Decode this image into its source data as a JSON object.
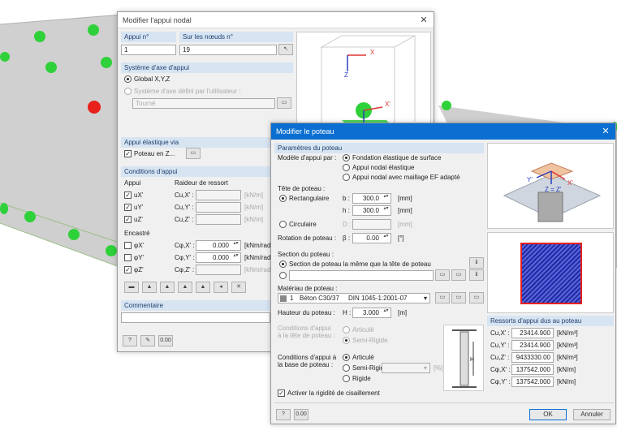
{
  "nodal_dialog": {
    "title": "Modifier l'appui nodal",
    "support_no_label": "Appui n°",
    "support_no_value": "1",
    "nodes_label": "Sur les nœuds n°",
    "nodes_value": "19",
    "axis_section": "Système d'axe d'appui",
    "global_label": "Global X,Y,Z",
    "user_axis_label": "Système d'axe défini par l'utilisateur :",
    "rotated_value": "Tourné",
    "elastic_section": "Appui élastique via",
    "column_label": "Poteau en Z...",
    "conditions_section": "Conditions d'appui",
    "support_col": "Appui",
    "spring_col": "Raideur de ressort",
    "rows_u": [
      {
        "axis": "uX'",
        "coef": "Cu,X' :",
        "unit": "[kN/m]"
      },
      {
        "axis": "uY'",
        "coef": "Cu,Y' :",
        "unit": "[kN/m]"
      },
      {
        "axis": "uZ'",
        "coef": "Cu,Z' :",
        "unit": "[kN/m]"
      }
    ],
    "fixed_label": "Encastré",
    "rows_phi": [
      {
        "axis": "φX'",
        "coef": "Cφ,X' :",
        "value": "0.000",
        "unit": "[kNm/rad]"
      },
      {
        "axis": "φY'",
        "coef": "Cφ,Y' :",
        "value": "0.000",
        "unit": "[kNm/rad]"
      },
      {
        "axis": "φZ'",
        "coef": "Cφ,Z' :",
        "value": "",
        "unit": "[kNm/rad]"
      }
    ],
    "comment_section": "Commentaire"
  },
  "column_dialog": {
    "title": "Modifier le poteau",
    "params_section": "Paramètres du poteau",
    "model_label": "Modèle d'appui par :",
    "model_options": [
      "Fondation élastique de surface",
      "Appui nodal élastique",
      "Appui nodal avec maillage EF adapté"
    ],
    "head_label": "Tête de poteau :",
    "rect_label": "Rectangulaire",
    "b_label": "b :",
    "b_value": "300.0",
    "h_label": "h :",
    "h_value": "300.0",
    "unit_mm": "[mm]",
    "circ_label": "Circulaire",
    "d_label": "D :",
    "rotation_label": "Rotation de poteau :",
    "beta_label": "β :",
    "beta_value": "0.00",
    "unit_deg": "[°]",
    "section_label": "Section du poteau :",
    "section_same": "Section de poteau la même que la tête de poteau",
    "material_label": "Matériau de poteau :",
    "material_no": "1",
    "material_name": "Béton C30/37",
    "material_norm": "DIN 1045-1:2001-07",
    "height_label": "Hauteur du poteau :",
    "H_label": "H :",
    "H_value": "3.000",
    "unit_m": "[m]",
    "top_cond_label": "Conditions d'appui à la tête de poteau :",
    "top_opt1": "Articulé",
    "top_opt2": "Semi-Rigide",
    "base_cond_label": "Conditions d'appui à la base de poteau :",
    "base_opt1": "Articulé",
    "base_opt2": "Semi-Rigide",
    "base_opt3": "Rigide",
    "unit_pct": "[%]",
    "shear_label": "Activer la rigidité de cisaillement",
    "springs_section": "Ressorts d'appui dus au poteau",
    "springs": [
      {
        "label": "Cu,X' :",
        "value": "23414.900",
        "unit": "[kN/m³]"
      },
      {
        "label": "Cu,Y' :",
        "value": "23414.900",
        "unit": "[kN/m³]"
      },
      {
        "label": "Cu,Z' :",
        "value": "9433330.00",
        "unit": "[kN/m³]"
      },
      {
        "label": "Cφ,X' :",
        "value": "137542.000",
        "unit": "[kN/m]"
      },
      {
        "label": "Cφ,Y' :",
        "value": "137542.000",
        "unit": "[kN/m]"
      }
    ],
    "ok_label": "OK",
    "cancel_label": "Annuler"
  },
  "viewer_labels": {
    "x": "X",
    "z": "Z",
    "x_prime": "X'",
    "z_prime": "Z'",
    "y_prime": "Y'",
    "xz_prime": "Z = Z'"
  },
  "colors": {
    "accent": "#0a6fd1",
    "section": "#d7e4f2",
    "support_green": "#2fd13a",
    "support_red": "#e8211d",
    "column_section": "#1f2aa8"
  }
}
